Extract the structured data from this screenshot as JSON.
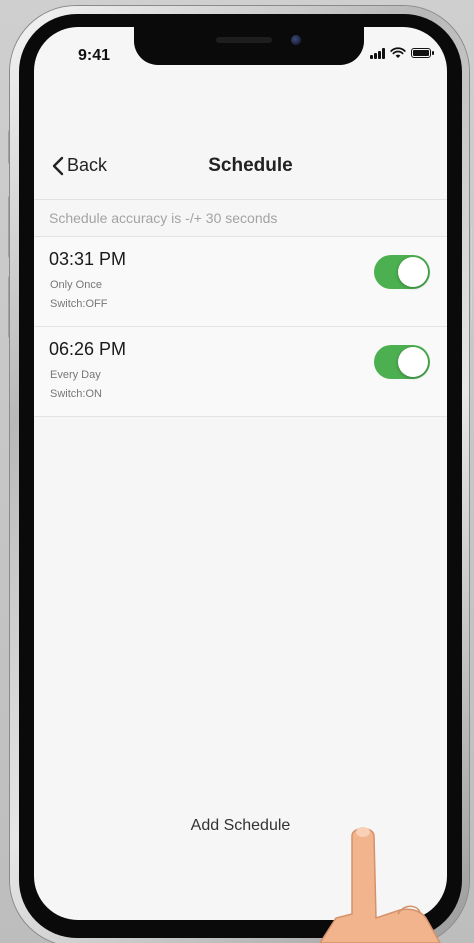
{
  "status_bar": {
    "time": "9:41"
  },
  "navbar": {
    "back_label": "Back",
    "title": "Schedule"
  },
  "notice": "Schedule accuracy is -/+ 30 seconds",
  "schedules": [
    {
      "time": "03:31 PM",
      "repeat": "Only Once",
      "state": "Switch:OFF",
      "enabled": true
    },
    {
      "time": "06:26 PM",
      "repeat": "Every Day",
      "state": "Switch:ON",
      "enabled": true
    }
  ],
  "add_schedule_label": "Add Schedule",
  "colors": {
    "toggle_on": "#4caf50",
    "screen_bg": "#f6f6f6",
    "notice_text": "#a3a3a3"
  },
  "icons": [
    "chevron-left-icon",
    "signal-icon",
    "wifi-icon",
    "battery-icon"
  ]
}
